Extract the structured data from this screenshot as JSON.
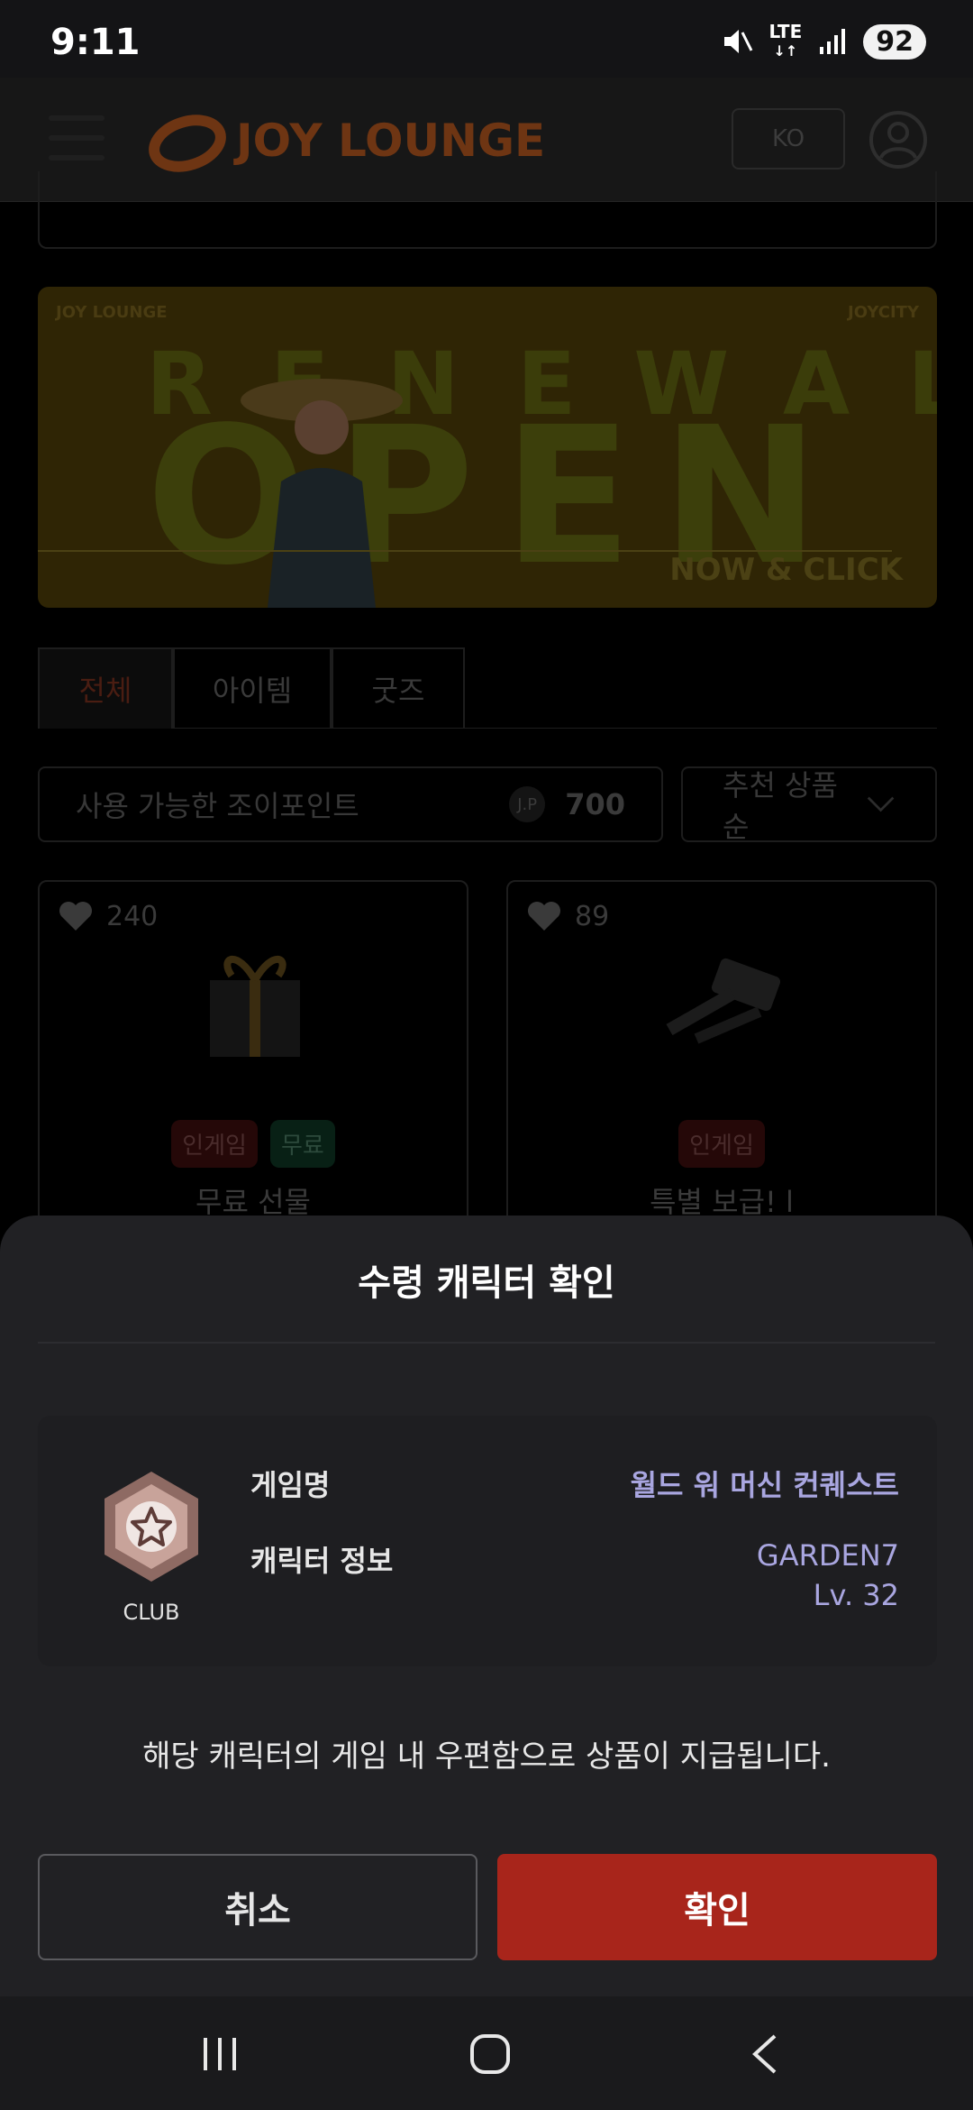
{
  "status_bar": {
    "time": "9:11",
    "network": "LTE",
    "battery": "92"
  },
  "header": {
    "logo": "JOY LOUNGE",
    "lang": "KO"
  },
  "banner": {
    "brand_left": "JOY LOUNGE",
    "brand_right": "JOYCITY",
    "headline_1": "RENEWAL",
    "headline_2": "OPEN",
    "cta_prefix": "NOW & ",
    "cta_strong": "CLICK"
  },
  "tabs": [
    {
      "label": "전체"
    },
    {
      "label": "아이템"
    },
    {
      "label": "굿즈"
    }
  ],
  "points": {
    "label": "사용 가능한 조이포인트",
    "currency": "J.P",
    "value": "700"
  },
  "sort": {
    "label": "추천 상품순"
  },
  "products": [
    {
      "likes": "240",
      "badges": [
        "인게임",
        "무료"
      ],
      "title": "무료 선물"
    },
    {
      "likes": "89",
      "badges": [
        "인게임"
      ],
      "title": "특별 보급! l"
    }
  ],
  "sheet": {
    "title": "수령 캐릭터 확인",
    "grade": "CLUB",
    "game_label": "게임명",
    "game_value": "월드 워 머신 컨퀘스트",
    "char_label": "캐릭터 정보",
    "char_name": "GARDEN7",
    "char_level": "Lv. 32",
    "notice": "해당 캐릭터의 게임 내 우편함으로 상품이 지급됩니다.",
    "cancel": "취소",
    "confirm": "확인"
  },
  "colors": {
    "accent": "#a8251b",
    "value_text": "#a9a6e0",
    "sheet_bg": "#212124"
  }
}
